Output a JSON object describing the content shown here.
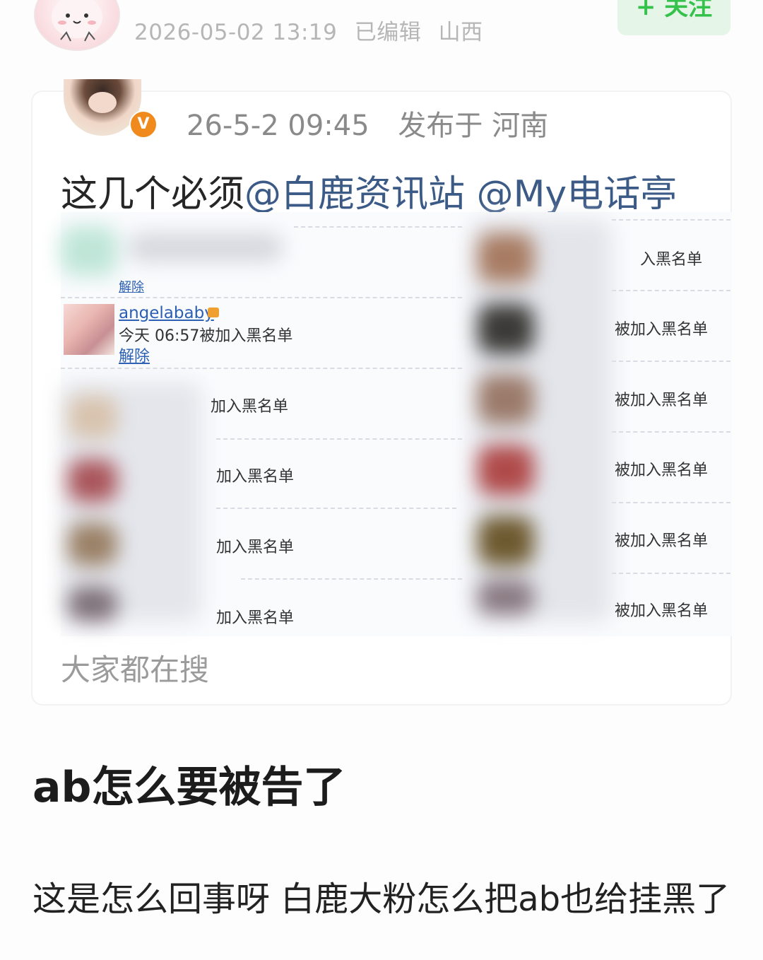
{
  "header": {
    "timestamp": "2026-05-02 13:19",
    "edited": "已编辑",
    "location": "山西",
    "follow_label": "+ 关注"
  },
  "quoted_post": {
    "verified_badge": "V",
    "timestamp": "26-5-2 09:45",
    "published_from": "发布于 河南",
    "text_prefix": "这几个必须",
    "mention_1": "@白鹿资讯站",
    "mention_2": "@My电话亭",
    "search_hint": "大家都在搜",
    "blacklist": {
      "visible_entry": {
        "username": "angelababy",
        "status": "今天 06:57被加入黑名单",
        "action": "解除"
      },
      "first_row_action": "解除",
      "left_column_status": [
        "加入黑名单",
        "加入黑名单",
        "加入黑名单",
        "加入黑名单"
      ],
      "right_column_status": [
        "入黑名单",
        "被加入黑名单",
        "被加入黑名单",
        "被加入黑名单",
        "被加入黑名单",
        "被加入黑名单"
      ]
    }
  },
  "post": {
    "title": "ab怎么要被告了",
    "body": "这是怎么回事呀 白鹿大粉怎么把ab也给挂黑了"
  },
  "colors": {
    "follow_green": "#35c24b",
    "mention_blue": "#3c5a86",
    "badge_orange": "#f08a1c"
  }
}
